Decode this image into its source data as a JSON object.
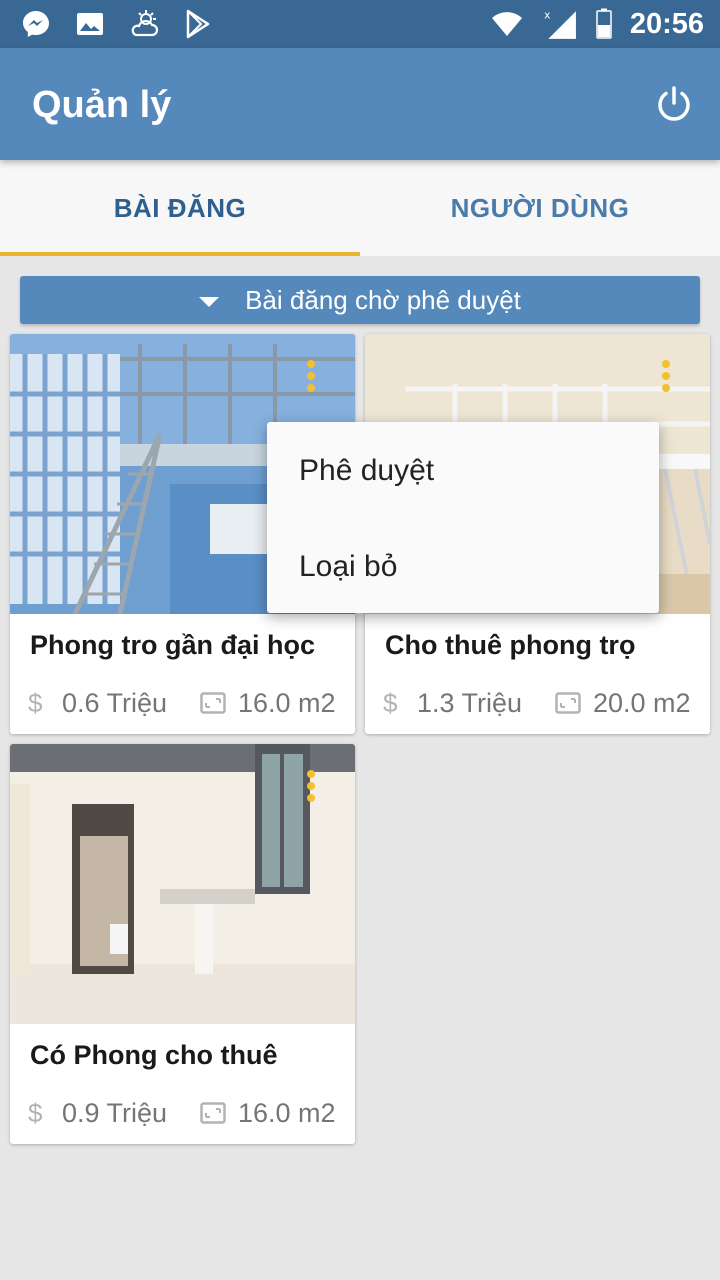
{
  "status_bar": {
    "time": "20:56",
    "left_icons": [
      "messenger-icon",
      "image-icon",
      "weather-icon",
      "play-store-icon"
    ],
    "right_icons": [
      "wifi-icon",
      "cellular-signal-icon",
      "battery-icon"
    ]
  },
  "app_bar": {
    "title": "Quản lý",
    "action_icon": "power-icon"
  },
  "tabs": [
    {
      "label": "BÀI ĐĂNG",
      "active": true
    },
    {
      "label": "NGƯỜI DÙNG",
      "active": false
    }
  ],
  "colors": {
    "primary": "#5589bc",
    "status_bar": "#3a6894",
    "tab_indicator": "#e8b431",
    "menu_dots": "#f2c12e"
  },
  "filter": {
    "selected": "Bài đăng chờ phê duyệt",
    "icon": "caret-down-icon"
  },
  "posts": [
    {
      "title": "Phong tro gần đại học",
      "price": "0.6 Triệu",
      "area": "16.0 m2",
      "currency_icon": "dollar-icon",
      "area_icon": "area-icon",
      "menu_icon": "more-vert-icon"
    },
    {
      "title": "Cho thuê phong trọ",
      "price": "1.3 Triệu",
      "area": "20.0 m2",
      "currency_icon": "dollar-icon",
      "area_icon": "area-icon",
      "menu_icon": "more-vert-icon"
    },
    {
      "title": "Có Phong cho thuê",
      "price": "0.9 Triệu",
      "area": "16.0 m2",
      "currency_icon": "dollar-icon",
      "area_icon": "area-icon",
      "menu_icon": "more-vert-icon"
    }
  ],
  "popup_menu": {
    "items": [
      "Phê duyệt",
      "Loại bỏ"
    ]
  }
}
